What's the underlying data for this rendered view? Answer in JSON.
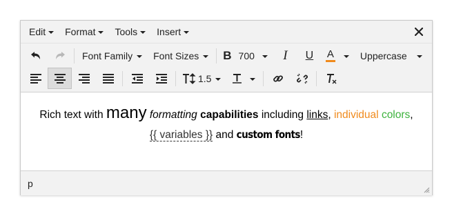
{
  "menubar": {
    "items": [
      {
        "label": "Edit"
      },
      {
        "label": "Format"
      },
      {
        "label": "Tools"
      },
      {
        "label": "Insert"
      }
    ],
    "close_icon": "close-icon"
  },
  "toolbar": {
    "font_family_label": "Font Family",
    "font_sizes_label": "Font Sizes",
    "font_weight_value": "700",
    "text_transform_label": "Uppercase",
    "line_height_value": "1.5",
    "text_color_accent": "#f08a1c"
  },
  "content": {
    "p1": "Rich text with ",
    "big": "many",
    "s2": " ",
    "italic": "formatting",
    "s3": " ",
    "bold": "capabilities",
    "s4": " including ",
    "link": "links",
    "s5": ", ",
    "orange": "individual",
    "s6": " ",
    "green": "colors",
    "s7": ",",
    "var": "{{ variables }}",
    "s8": " and ",
    "custom": "custom fonts",
    "s9": "!"
  },
  "status": {
    "path": "p"
  }
}
